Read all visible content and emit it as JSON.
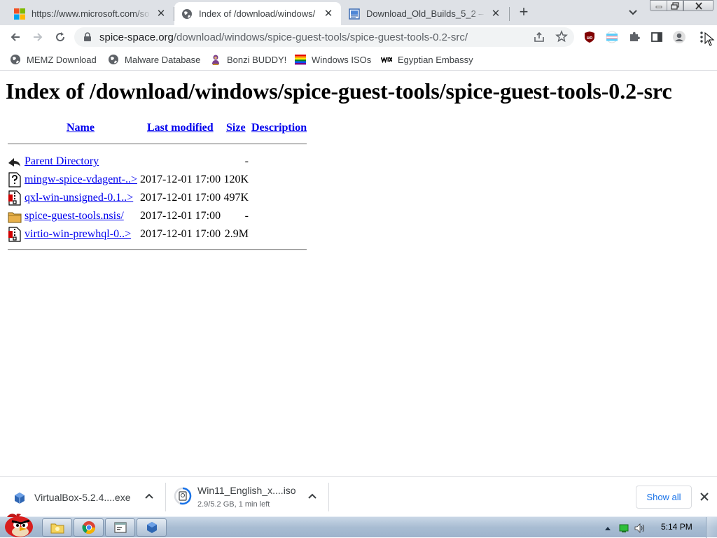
{
  "browser": {
    "tabs": [
      {
        "title": "https://www.microsoft.com/so",
        "favicon": "microsoft-logo-icon",
        "active": false
      },
      {
        "title": "Index of /download/windows/",
        "favicon": "globe-icon",
        "active": true
      },
      {
        "title": "Download_Old_Builds_5_2 – O",
        "favicon": "wiki-page-icon",
        "active": false
      }
    ],
    "new_tab_label": "+",
    "address": {
      "host": "spice-space.org",
      "path": "/download/windows/spice-guest-tools/spice-guest-tools-0.2-src/"
    },
    "toolbar_icons": [
      "back-icon",
      "forward-icon",
      "reload-icon",
      "lock-icon",
      "share-icon",
      "star-icon",
      "ublock-icon",
      "flag-extension-icon",
      "puzzle-icon",
      "sidepanel-icon",
      "profile-icon",
      "menu-icon"
    ],
    "bookmarks": [
      {
        "label": "MEMZ Download",
        "icon": "globe-icon"
      },
      {
        "label": "Malware Database",
        "icon": "globe-icon"
      },
      {
        "label": "Bonzi BUDDY!",
        "icon": "bonzi-icon"
      },
      {
        "label": "Windows ISOs",
        "icon": "rainbow-flag-icon"
      },
      {
        "label": "Egyptian Embassy",
        "icon": "wix-icon"
      }
    ]
  },
  "page": {
    "heading": "Index of /download/windows/spice-guest-tools/spice-guest-tools-0.2-src",
    "columns": {
      "name": "Name",
      "last_modified": "Last modified",
      "size": "Size",
      "description": "Description"
    },
    "rows": [
      {
        "name": "Parent Directory",
        "date": "",
        "size": "-",
        "icon": "back-arrow-icon"
      },
      {
        "name": "mingw-spice-vdagent-..>",
        "date": "2017-12-01 17:00",
        "size": "120K",
        "icon": "unknown-file-icon"
      },
      {
        "name": "qxl-win-unsigned-0.1..>",
        "date": "2017-12-01 17:00",
        "size": "497K",
        "icon": "archive-file-icon"
      },
      {
        "name": "spice-guest-tools.nsis/",
        "date": "2017-12-01 17:00",
        "size": "-",
        "icon": "folder-icon"
      },
      {
        "name": "virtio-win-prewhql-0..>",
        "date": "2017-12-01 17:00",
        "size": "2.9M",
        "icon": "archive-file-icon"
      }
    ]
  },
  "downloads": {
    "items": [
      {
        "name": "VirtualBox-5.2.4....exe",
        "status": ""
      },
      {
        "name": "Win11_English_x....iso",
        "status": "2.9/5.2 GB, 1 min left"
      }
    ],
    "show_all_label": "Show all"
  },
  "taskbar": {
    "clock": "5:14 PM",
    "pinned": [
      "explorer-icon",
      "chrome-icon",
      "window-icon",
      "virtualbox-icon"
    ]
  }
}
